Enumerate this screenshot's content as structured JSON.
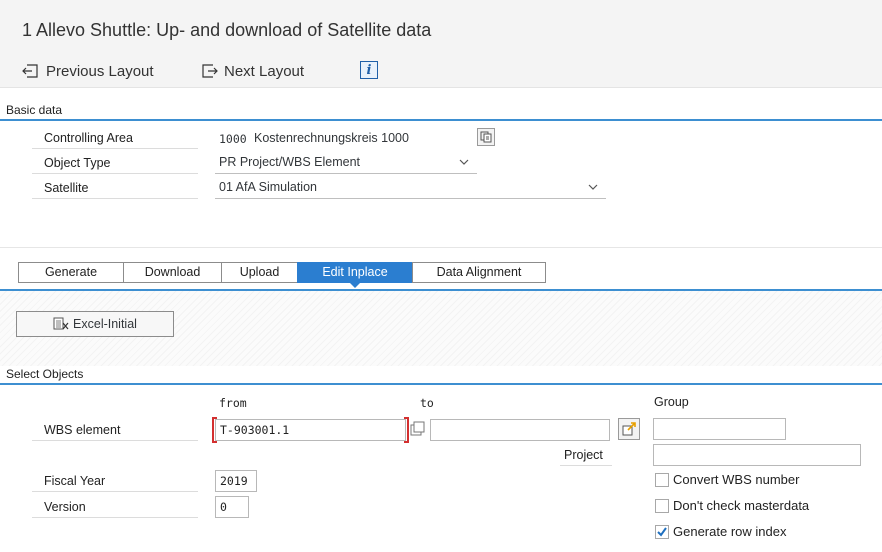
{
  "window": {
    "title": "1 Allevo Shuttle: Up- and download of Satellite data"
  },
  "toolbar": {
    "previous_label": "Previous Layout",
    "next_label": "Next Layout",
    "info_label": "i"
  },
  "basic": {
    "header": "Basic data",
    "controlling_area": {
      "label": "Controlling Area",
      "code": "1000",
      "text": "Kostenrechnungskreis 1000"
    },
    "object_type": {
      "label": "Object Type",
      "value": "PR Project/WBS Element"
    },
    "satellite": {
      "label": "Satellite",
      "value": "01 AfA Simulation"
    }
  },
  "tabs": [
    {
      "label": "Generate",
      "active": false
    },
    {
      "label": "Download",
      "active": false
    },
    {
      "label": "Upload",
      "active": false
    },
    {
      "label": "Edit Inplace",
      "active": true
    },
    {
      "label": "Data Alignment",
      "active": false
    }
  ],
  "excel_button": {
    "label": "Excel-Initial"
  },
  "select": {
    "header": "Select Objects",
    "from_label": "from",
    "to_label": "to",
    "group_label": "Group",
    "project_label": "Project",
    "wbs": {
      "label": "WBS element",
      "from": "T-903001.1",
      "to": ""
    },
    "group_value": "",
    "project_value": "",
    "fiscal_year": {
      "label": "Fiscal Year",
      "value": "2019"
    },
    "version": {
      "label": "Version",
      "value": "0"
    },
    "options": [
      {
        "label": "Convert WBS number",
        "checked": false
      },
      {
        "label": "Don't check masterdata",
        "checked": false
      },
      {
        "label": "Generate row index",
        "checked": true
      }
    ]
  },
  "colors": {
    "accent": "#3d8fd1",
    "active_tab": "#2b7ed0",
    "focus": "#d32f2f"
  }
}
